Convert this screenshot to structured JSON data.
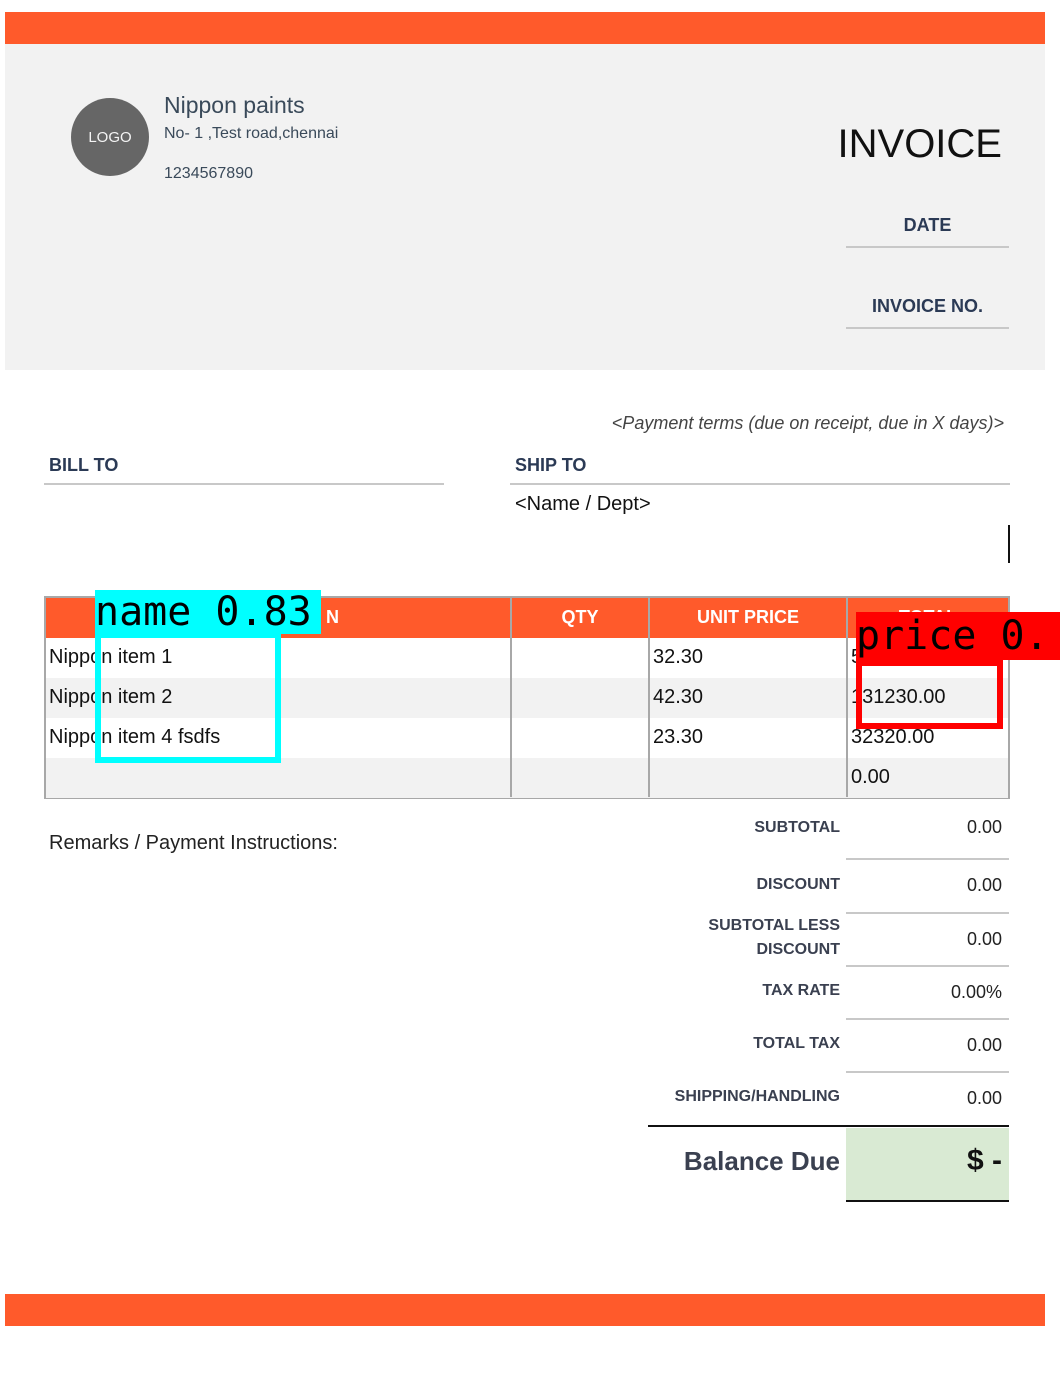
{
  "company": {
    "logo_text": "LOGO",
    "name": "Nippon paints",
    "address": "No- 1 ,Test road,chennai",
    "phone": "1234567890"
  },
  "invoice": {
    "title": "INVOICE",
    "date_label": "DATE",
    "number_label": "INVOICE NO.",
    "payment_terms": "<Payment terms (due on receipt, due in X days)>"
  },
  "parties": {
    "bill_to_label": "BILL TO",
    "ship_to_label": "SHIP TO",
    "ship_to_name": "<Name / Dept>"
  },
  "items": {
    "headers": {
      "description_visible": "N",
      "qty": "QTY",
      "unit_price": "UNIT PRICE",
      "total_partial": "TOTAL"
    },
    "rows": [
      {
        "description": "Nippon item 1",
        "qty": "",
        "unit_price": "32.30",
        "total": "5"
      },
      {
        "description": "Nippon item 2",
        "qty": "",
        "unit_price": "42.30",
        "total": "131230.00"
      },
      {
        "description": "Nippon item 4 fsdfs",
        "qty": "",
        "unit_price": "23.30",
        "total": "32320.00"
      },
      {
        "description": "",
        "qty": "",
        "unit_price": "",
        "total": "0.00"
      }
    ]
  },
  "remarks_label": "Remarks / Payment Instructions:",
  "totals": {
    "subtotal_label": "SUBTOTAL",
    "subtotal": "0.00",
    "discount_label": "DISCOUNT",
    "discount": "0.00",
    "subtotal_less_label_1": "SUBTOTAL LESS",
    "subtotal_less_label_2": "DISCOUNT",
    "subtotal_less": "0.00",
    "tax_rate_label": "TAX RATE",
    "tax_rate": "0.00%",
    "total_tax_label": "TOTAL TAX",
    "total_tax": "0.00",
    "shipping_label": "SHIPPING/HANDLING",
    "shipping": "0.00",
    "balance_label": "Balance Due",
    "balance": "$ -"
  },
  "detections": [
    {
      "label": "name 0.83",
      "color": "#00ffff"
    },
    {
      "label": "price 0.",
      "color": "#ff0000"
    }
  ],
  "colors": {
    "accent": "#ff5a2b",
    "header_bg": "#f2f2f2",
    "label_text": "#2b3a55",
    "balance_bg": "#d9ead3"
  }
}
